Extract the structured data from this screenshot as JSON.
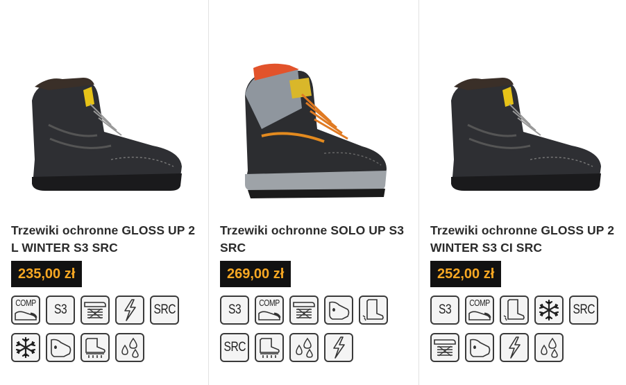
{
  "products": [
    {
      "title": "Trzewiki ochronne GLOSS UP 2 L WINTER S3 SRC",
      "price": "235,00 zł",
      "image": "black-winter-safety-boot",
      "badges": [
        {
          "icon": "comp-toecap-icon",
          "label": "COMP"
        },
        {
          "icon": "s3-icon",
          "label": "S3"
        },
        {
          "icon": "energy-absorption-heel-icon",
          "label": ""
        },
        {
          "icon": "antistatic-icon",
          "label": ""
        },
        {
          "icon": "src-slip-icon",
          "label": "SRC"
        },
        {
          "icon": "cold-insulation-icon",
          "label": ""
        },
        {
          "icon": "water-resistant-upper-icon",
          "label": ""
        },
        {
          "icon": "penetration-resistant-sole-icon",
          "label": ""
        },
        {
          "icon": "oil-resistant-icon",
          "label": ""
        }
      ]
    },
    {
      "title": "Trzewiki ochronne SOLO UP S3 SRC",
      "price": "269,00 zł",
      "image": "grey-orange-safety-boot",
      "badges": [
        {
          "icon": "s3-icon",
          "label": "S3"
        },
        {
          "icon": "comp-toecap-icon",
          "label": "COMP"
        },
        {
          "icon": "energy-absorption-heel-icon",
          "label": ""
        },
        {
          "icon": "water-resistant-upper-icon",
          "label": ""
        },
        {
          "icon": "cold-boot-icon",
          "label": ""
        },
        {
          "icon": "src-slip-icon",
          "label": "SRC"
        },
        {
          "icon": "penetration-resistant-sole-icon",
          "label": ""
        },
        {
          "icon": "oil-resistant-icon",
          "label": ""
        },
        {
          "icon": "antistatic-icon",
          "label": ""
        }
      ]
    },
    {
      "title": "Trzewiki ochronne GLOSS UP 2 WINTER S3 CI SRC",
      "price": "252,00 zł",
      "image": "black-winter-safety-boot",
      "badges": [
        {
          "icon": "s3-icon",
          "label": "S3"
        },
        {
          "icon": "comp-toecap-icon",
          "label": "COMP"
        },
        {
          "icon": "cold-boot-icon",
          "label": ""
        },
        {
          "icon": "cold-insulation-icon",
          "label": ""
        },
        {
          "icon": "src-slip-icon",
          "label": "SRC"
        },
        {
          "icon": "energy-absorption-heel-icon",
          "label": ""
        },
        {
          "icon": "water-resistant-upper-icon",
          "label": ""
        },
        {
          "icon": "antistatic-icon",
          "label": ""
        },
        {
          "icon": "oil-resistant-icon",
          "label": ""
        }
      ]
    }
  ],
  "colors": {
    "price_bg": "#111111",
    "price_text": "#f7a823",
    "title_text": "#2b2b2b",
    "divider": "#e2e2e2"
  }
}
